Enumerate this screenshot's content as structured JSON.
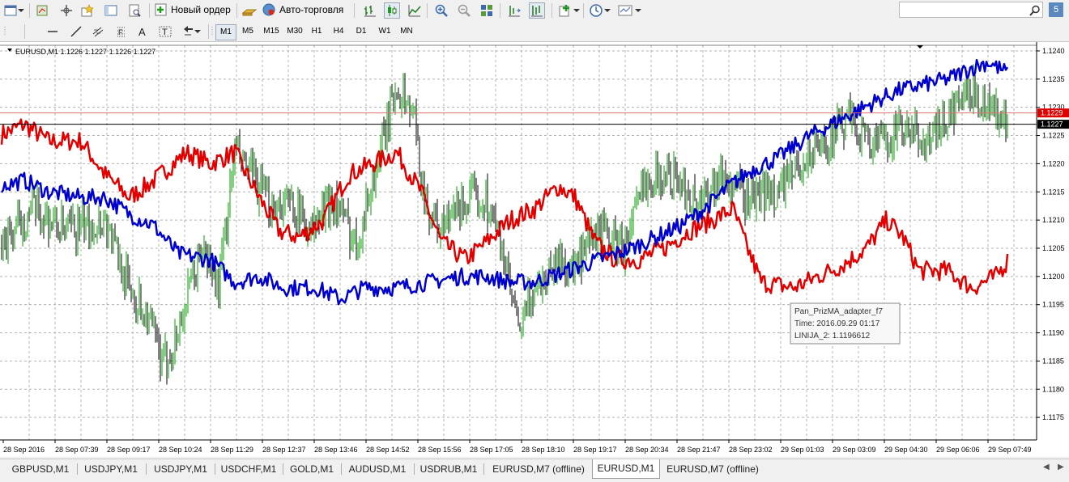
{
  "toolbar": {
    "new_order_label": "Новый ордер",
    "autotrading_label": "Авто-торговля",
    "timeframes": [
      "M1",
      "M5",
      "M15",
      "M30",
      "H1",
      "H4",
      "D1",
      "W1",
      "MN"
    ],
    "active_timeframe": "M1",
    "notifications_count": "5"
  },
  "chart": {
    "symbol_header": "EURUSD,M1  1.1226 1.1227 1.1226 1.1227",
    "price_ticks": [
      "1.1240",
      "1.1235",
      "1.1230",
      "1.1225",
      "1.1220",
      "1.1215",
      "1.1210",
      "1.1205",
      "1.1200",
      "1.1195",
      "1.1190",
      "1.1185",
      "1.1180",
      "1.1175"
    ],
    "current_price": "1.1227",
    "red_line_price": "1.1229",
    "time_ticks": [
      "28 Sep 2016",
      "28 Sep 07:39",
      "28 Sep 09:17",
      "28 Sep 10:24",
      "28 Sep 11:29",
      "28 Sep 12:37",
      "28 Sep 13:46",
      "28 Sep 14:52",
      "28 Sep 15:56",
      "28 Sep 17:05",
      "28 Sep 18:10",
      "28 Sep 19:17",
      "28 Sep 20:34",
      "28 Sep 21:47",
      "28 Sep 23:02",
      "29 Sep 01:03",
      "29 Sep 03:09",
      "29 Sep 04:30",
      "29 Sep 06:06",
      "29 Sep 07:49"
    ],
    "tooltip": {
      "name": "Pan_PrizMA_adapter_f7",
      "time": "Time: 2016.09.29 01:17",
      "value": "LINIJA_2: 1.1196612"
    },
    "colors": {
      "price_bull": "#00a000",
      "price_bear": "#000000",
      "red_series": "#e00000",
      "blue_series": "#0000cc",
      "grid": "#b0b0b0"
    }
  },
  "chart_data": {
    "type": "line",
    "ylim": [
      1.1171,
      1.1241
    ],
    "series": [
      {
        "color": "#00a000",
        "points": [
          [
            0,
            1.1205
          ],
          [
            40,
            1.1212
          ],
          [
            80,
            1.1208
          ],
          [
            130,
            1.121
          ],
          [
            160,
            1.1198
          ],
          [
            185,
            1.1192
          ],
          [
            200,
            1.1184
          ],
          [
            215,
            1.1188
          ],
          [
            235,
            1.1198
          ],
          [
            250,
            1.1205
          ],
          [
            270,
            1.1198
          ],
          [
            290,
            1.1222
          ],
          [
            310,
            1.1218
          ],
          [
            330,
            1.1213
          ],
          [
            360,
            1.1213
          ],
          [
            385,
            1.1208
          ],
          [
            410,
            1.1214
          ],
          [
            440,
            1.1206
          ],
          [
            470,
            1.1222
          ],
          [
            490,
            1.1234
          ],
          [
            510,
            1.1229
          ],
          [
            525,
            1.1213
          ],
          [
            545,
            1.1208
          ],
          [
            570,
            1.1213
          ],
          [
            600,
            1.1214
          ],
          [
            620,
            1.1205
          ],
          [
            640,
            1.119
          ],
          [
            660,
            1.1198
          ],
          [
            690,
            1.1203
          ],
          [
            710,
            1.1201
          ],
          [
            740,
            1.1208
          ],
          [
            770,
            1.1205
          ],
          [
            800,
            1.1218
          ],
          [
            830,
            1.1218
          ],
          [
            860,
            1.1213
          ],
          [
            890,
            1.1218
          ],
          [
            920,
            1.1214
          ],
          [
            960,
            1.1215
          ],
          [
            990,
            1.122
          ],
          [
            1020,
            1.1224
          ],
          [
            1050,
            1.1228
          ],
          [
            1080,
            1.1223
          ],
          [
            1110,
            1.1226
          ],
          [
            1150,
            1.1224
          ],
          [
            1180,
            1.123
          ],
          [
            1200,
            1.1233
          ],
          [
            1220,
            1.1231
          ],
          [
            1245,
            1.1226
          ]
        ]
      },
      {
        "color": "#e00000",
        "points": [
          [
            0,
            1.1225
          ],
          [
            30,
            1.1227
          ],
          [
            60,
            1.1224
          ],
          [
            100,
            1.1224
          ],
          [
            130,
            1.1218
          ],
          [
            160,
            1.1214
          ],
          [
            190,
            1.1217
          ],
          [
            230,
            1.1222
          ],
          [
            260,
            1.122
          ],
          [
            290,
            1.1222
          ],
          [
            320,
            1.1214
          ],
          [
            345,
            1.1208
          ],
          [
            370,
            1.1207
          ],
          [
            400,
            1.121
          ],
          [
            430,
            1.1218
          ],
          [
            460,
            1.122
          ],
          [
            490,
            1.1222
          ],
          [
            520,
            1.1215
          ],
          [
            545,
            1.1206
          ],
          [
            575,
            1.1203
          ],
          [
            600,
            1.1206
          ],
          [
            630,
            1.121
          ],
          [
            660,
            1.1212
          ],
          [
            690,
            1.1216
          ],
          [
            710,
            1.1214
          ],
          [
            735,
            1.1206
          ],
          [
            760,
            1.1203
          ],
          [
            790,
            1.1203
          ],
          [
            820,
            1.1205
          ],
          [
            850,
            1.1208
          ],
          [
            880,
            1.121
          ],
          [
            905,
            1.1212
          ],
          [
            920,
            1.1206
          ],
          [
            940,
            1.1199
          ],
          [
            980,
            1.1198
          ],
          [
            1010,
            1.12
          ],
          [
            1040,
            1.1202
          ],
          [
            1070,
            1.1205
          ],
          [
            1095,
            1.121
          ],
          [
            1115,
            1.1207
          ],
          [
            1135,
            1.1201
          ],
          [
            1170,
            1.1201
          ],
          [
            1200,
            1.1198
          ],
          [
            1230,
            1.12
          ],
          [
            1245,
            1.1203
          ]
        ]
      },
      {
        "color": "#0000cc",
        "points": [
          [
            0,
            1.1216
          ],
          [
            30,
            1.1217
          ],
          [
            60,
            1.1215
          ],
          [
            100,
            1.1214
          ],
          [
            130,
            1.1214
          ],
          [
            160,
            1.1211
          ],
          [
            190,
            1.1209
          ],
          [
            220,
            1.1204
          ],
          [
            260,
            1.1203
          ],
          [
            290,
            1.1199
          ],
          [
            320,
            1.12
          ],
          [
            350,
            1.1198
          ],
          [
            390,
            1.1198
          ],
          [
            420,
            1.1196
          ],
          [
            450,
            1.1198
          ],
          [
            490,
            1.1198
          ],
          [
            530,
            1.1199
          ],
          [
            570,
            1.12
          ],
          [
            600,
            1.12
          ],
          [
            630,
            1.1199
          ],
          [
            660,
            1.1199
          ],
          [
            700,
            1.1201
          ],
          [
            740,
            1.1203
          ],
          [
            780,
            1.1205
          ],
          [
            810,
            1.1207
          ],
          [
            840,
            1.1209
          ],
          [
            870,
            1.1212
          ],
          [
            900,
            1.1216
          ],
          [
            930,
            1.1219
          ],
          [
            960,
            1.1221
          ],
          [
            1000,
            1.1225
          ],
          [
            1040,
            1.1228
          ],
          [
            1080,
            1.1231
          ],
          [
            1110,
            1.1233
          ],
          [
            1140,
            1.1234
          ],
          [
            1170,
            1.1235
          ],
          [
            1200,
            1.1237
          ],
          [
            1220,
            1.1238
          ],
          [
            1245,
            1.1236
          ]
        ]
      }
    ]
  },
  "tabs": [
    {
      "label": "GBPUSD,M1",
      "active": false
    },
    {
      "label": "USDJPY,M1",
      "active": false
    },
    {
      "label": "USDJPY,M1",
      "active": false
    },
    {
      "label": "USDCHF,M1",
      "active": false
    },
    {
      "label": "GOLD,M1",
      "active": false
    },
    {
      "label": "AUDUSD,M1",
      "active": false
    },
    {
      "label": "USDRUB,M1",
      "active": false
    },
    {
      "label": "EURUSD,M7 (offline)",
      "active": false
    },
    {
      "label": "EURUSD,M1",
      "active": true
    },
    {
      "label": "EURUSD,M7 (offline)",
      "active": false
    }
  ]
}
